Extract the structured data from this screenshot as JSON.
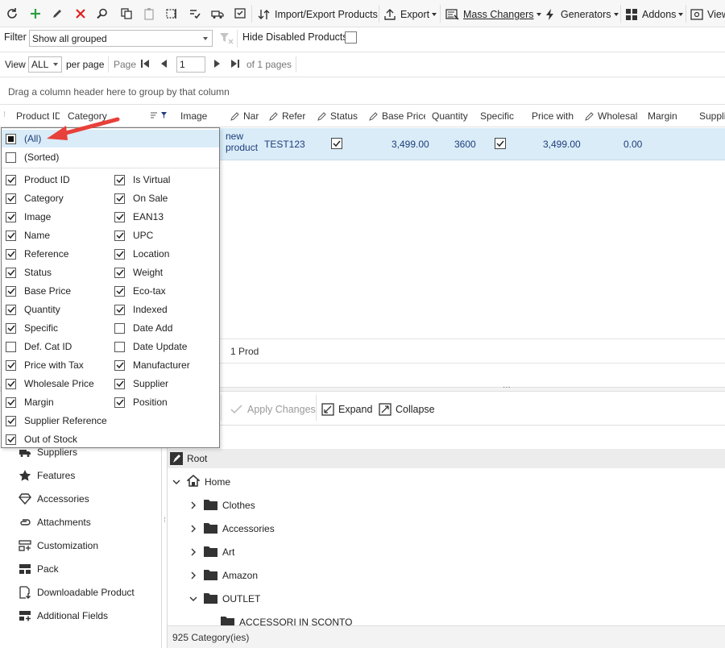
{
  "toolbar": {
    "import_export": "Import/Export Products",
    "export": "Export",
    "mass_changers": "Mass Changers",
    "generators": "Generators",
    "addons": "Addons",
    "view": "View"
  },
  "filter_bar": {
    "filter_label": "Filter",
    "filter_value": "Show all grouped",
    "hide_disabled_label": "Hide Disabled Products"
  },
  "pager": {
    "view_label": "View",
    "view_value": "ALL",
    "per_page_label": "per page",
    "page_label": "Page",
    "page_value": "1",
    "of_pages": "of 1 pages"
  },
  "group_hint": "Drag a column header here to group by that column",
  "grid": {
    "columns": [
      "Product ID",
      "Category",
      "Image",
      "Nar",
      "Refer",
      "Status",
      "Base Price",
      "Quantity",
      "Specific",
      "Price with",
      "Wholesal",
      "Margin",
      "Suppli"
    ],
    "row": {
      "name": "new product",
      "name_line1": "new",
      "name_line2": "product",
      "reference": "TEST123",
      "status_checked": true,
      "base_price": "3,499.00",
      "quantity": "3600",
      "specific_checked": true,
      "price_with_tax": "3,499.00",
      "wholesale_price": "0.00"
    },
    "footer_count": "1 Prod"
  },
  "column_chooser": {
    "all_label": "(All)",
    "sorted_label": "(Sorted)",
    "left_column": [
      {
        "label": "Product ID",
        "checked": true
      },
      {
        "label": "Category",
        "checked": true
      },
      {
        "label": "Image",
        "checked": true
      },
      {
        "label": "Name",
        "checked": true
      },
      {
        "label": "Reference",
        "checked": true
      },
      {
        "label": "Status",
        "checked": true
      },
      {
        "label": "Base Price",
        "checked": true
      },
      {
        "label": "Quantity",
        "checked": true
      },
      {
        "label": "Specific",
        "checked": true
      },
      {
        "label": "Def. Cat ID",
        "checked": false
      },
      {
        "label": "Price with Tax",
        "checked": true
      },
      {
        "label": "Wholesale Price",
        "checked": true
      },
      {
        "label": "Margin",
        "checked": true
      },
      {
        "label": "Supplier Reference",
        "checked": true
      },
      {
        "label": "Out of Stock",
        "checked": true
      }
    ],
    "right_column": [
      {
        "label": "Is Virtual",
        "checked": true
      },
      {
        "label": "On Sale",
        "checked": true
      },
      {
        "label": "EAN13",
        "checked": true
      },
      {
        "label": "UPC",
        "checked": true
      },
      {
        "label": "Location",
        "checked": true
      },
      {
        "label": "Weight",
        "checked": true
      },
      {
        "label": "Eco-tax",
        "checked": true
      },
      {
        "label": "Indexed",
        "checked": true
      },
      {
        "label": "Date Add",
        "checked": false
      },
      {
        "label": "Date Update",
        "checked": false
      },
      {
        "label": "Manufacturer",
        "checked": true
      },
      {
        "label": "Supplier",
        "checked": true
      },
      {
        "label": "Position",
        "checked": true
      }
    ],
    "arrow_color": "#e8403a"
  },
  "lower_toolbar": {
    "apply": "Apply Changes",
    "expand": "Expand",
    "collapse": "Collapse"
  },
  "left_panel": {
    "items": [
      "Suppliers",
      "Features",
      "Accessories",
      "Attachments",
      "Customization",
      "Pack",
      "Downloadable Product",
      "Additional Fields"
    ]
  },
  "category_tree": {
    "root": "Root",
    "home": "Home",
    "children": [
      "Clothes",
      "Accessories",
      "Art",
      "Amazon",
      "OUTLET"
    ],
    "grandchild": "ACCESSORI IN SCONTO",
    "status": "925 Category(ies)"
  },
  "colors": {
    "selected_row": "#d9ecf8",
    "accent_blue": "#1f3d7a",
    "add_green": "#2ea043",
    "delete_red": "#e02020"
  }
}
